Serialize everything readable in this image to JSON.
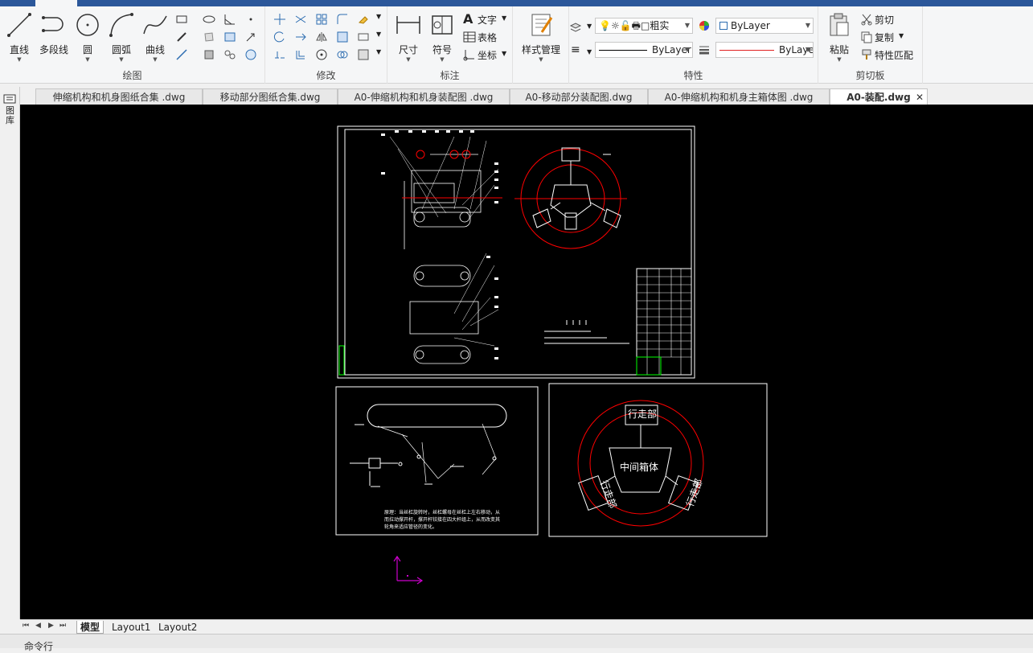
{
  "ribbon": {
    "draw": {
      "label": "绘图",
      "line": "直线",
      "polyline": "多段线",
      "circle": "圆",
      "arc": "圆弧",
      "spline": "曲线"
    },
    "modify": {
      "label": "修改"
    },
    "annotation": {
      "label": "标注",
      "dimension": "尺寸",
      "symbol": "符号",
      "text": "文字",
      "table": "表格",
      "coordinate": "坐标"
    },
    "style": {
      "manage": "样式管理"
    },
    "properties": {
      "label": "特性",
      "layer_value": "粗实",
      "color_value": "ByLayer",
      "linetype_value": "ByLayer",
      "lineweight_value": "ByLaye"
    },
    "clipboard": {
      "label": "剪切板",
      "paste": "粘贴",
      "cut": "剪切",
      "copy": "复制",
      "match": "特性匹配"
    }
  },
  "tabs": [
    {
      "label": "伸缩机构和机身图纸合集 .dwg"
    },
    {
      "label": "移动部分图纸合集.dwg"
    },
    {
      "label": "A0-伸缩机构和机身装配图 .dwg"
    },
    {
      "label": "A0-移动部分装配图.dwg"
    },
    {
      "label": "A0-伸缩机构和机身主箱体图 .dwg"
    },
    {
      "label": "A0-装配.dwg",
      "active": true
    }
  ],
  "left_strip": {
    "label": "图库"
  },
  "drawing": {
    "labels": {
      "walk_top": "行走部",
      "walk_left": "行走部",
      "walk_right": "行走部",
      "center_box": "中间箱体"
    },
    "note": [
      "原理：当丝杠旋转时，丝杠螺母在丝杠上左右移动，从",
      "而拉动撑开杆，撑开杆铰接在四大杆组上，从而改变其",
      "轮角来适应管径的变化。"
    ]
  },
  "layouts": {
    "model": "模型",
    "layout1": "Layout1",
    "layout2": "Layout2"
  },
  "command": {
    "label": "命令行"
  },
  "colors": {
    "accent": "#2b579a",
    "cad_red": "#ff0000",
    "cad_white": "#ffffff",
    "cad_green": "#00ff00",
    "ucs": "#cc00cc"
  }
}
